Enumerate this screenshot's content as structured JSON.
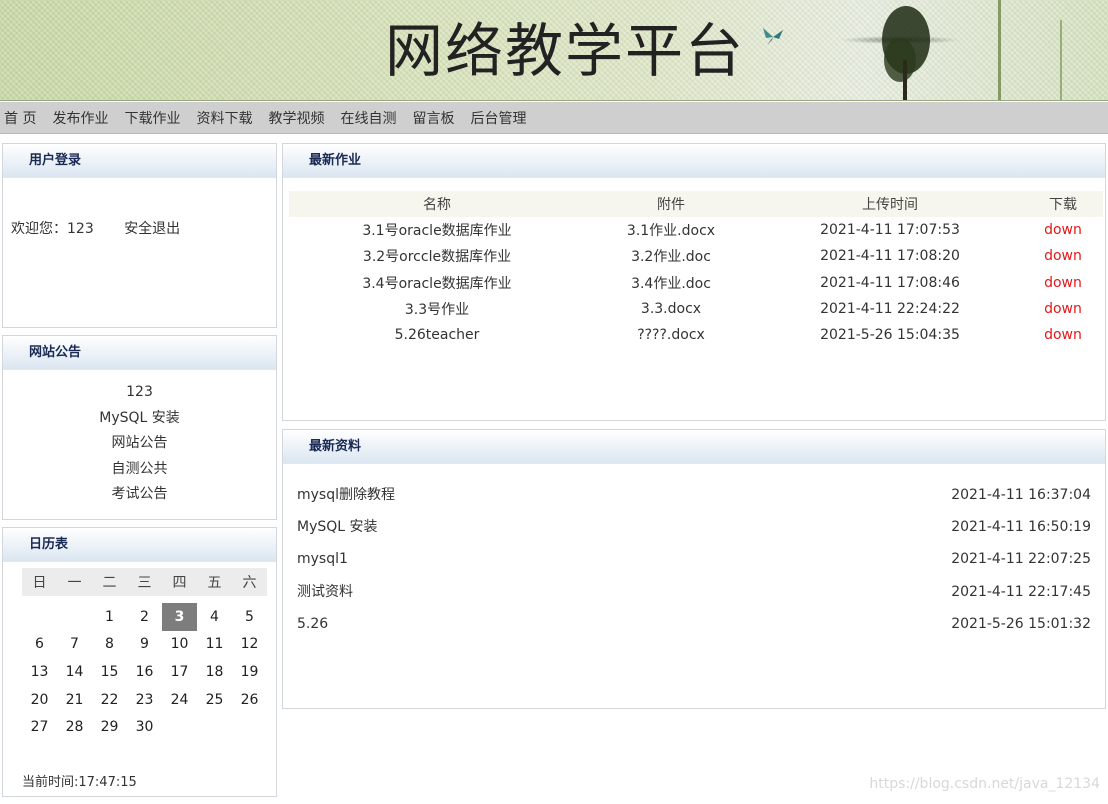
{
  "banner": {
    "title": "网络教学平台"
  },
  "nav": {
    "items": [
      "首 页",
      "发布作业",
      "下载作业",
      "资料下载",
      "教学视频",
      "在线自测",
      "留言板",
      "后台管理"
    ]
  },
  "login": {
    "title": "用户登录",
    "welcome": "欢迎您：123",
    "logout": "安全退出"
  },
  "notice": {
    "title": "网站公告",
    "items": [
      "123",
      "MySQL 安装",
      "网站公告",
      "自测公共",
      "考试公告"
    ]
  },
  "calendar": {
    "title": "日历表",
    "weekdays": [
      "日",
      "一",
      "二",
      "三",
      "四",
      "五",
      "六"
    ],
    "weeks": [
      [
        "",
        "",
        "1",
        "2",
        "3",
        "4",
        "5"
      ],
      [
        "6",
        "7",
        "8",
        "9",
        "10",
        "11",
        "12"
      ],
      [
        "13",
        "14",
        "15",
        "16",
        "17",
        "18",
        "19"
      ],
      [
        "20",
        "21",
        "22",
        "23",
        "24",
        "25",
        "26"
      ],
      [
        "27",
        "28",
        "29",
        "30",
        "",
        "",
        ""
      ]
    ],
    "today": "3",
    "current_time": "当前时间:17:47:15"
  },
  "homework": {
    "title": "最新作业",
    "columns": [
      "名称",
      "附件",
      "上传时间",
      "下载"
    ],
    "rows": [
      [
        "3.1号oracle数据库作业",
        "3.1作业.docx",
        "2021-4-11 17:07:53",
        "down"
      ],
      [
        "3.2号orccle数据库作业",
        "3.2作业.doc",
        "2021-4-11 17:08:20",
        "down"
      ],
      [
        "3.4号oracle数据库作业",
        "3.4作业.doc",
        "2021-4-11 17:08:46",
        "down"
      ],
      [
        "3.3号作业",
        "3.3.docx",
        "2021-4-11 22:24:22",
        "down"
      ],
      [
        "5.26teacher",
        "????.docx",
        "2021-5-26 15:04:35",
        "down"
      ]
    ],
    "link_color": "#e31818"
  },
  "materials": {
    "title": "最新资料",
    "items": [
      {
        "name": "mysql删除教程",
        "time": "2021-4-11 16:37:04"
      },
      {
        "name": "MySQL 安装",
        "time": "2021-4-11 16:50:19"
      },
      {
        "name": "mysql1",
        "time": "2021-4-11 22:07:25"
      },
      {
        "name": "测试资料",
        "time": "2021-4-11 22:17:45"
      },
      {
        "name": "5.26",
        "time": "2021-5-26 15:01:32"
      }
    ]
  },
  "watermark": "https://blog.csdn.net/java_12134"
}
